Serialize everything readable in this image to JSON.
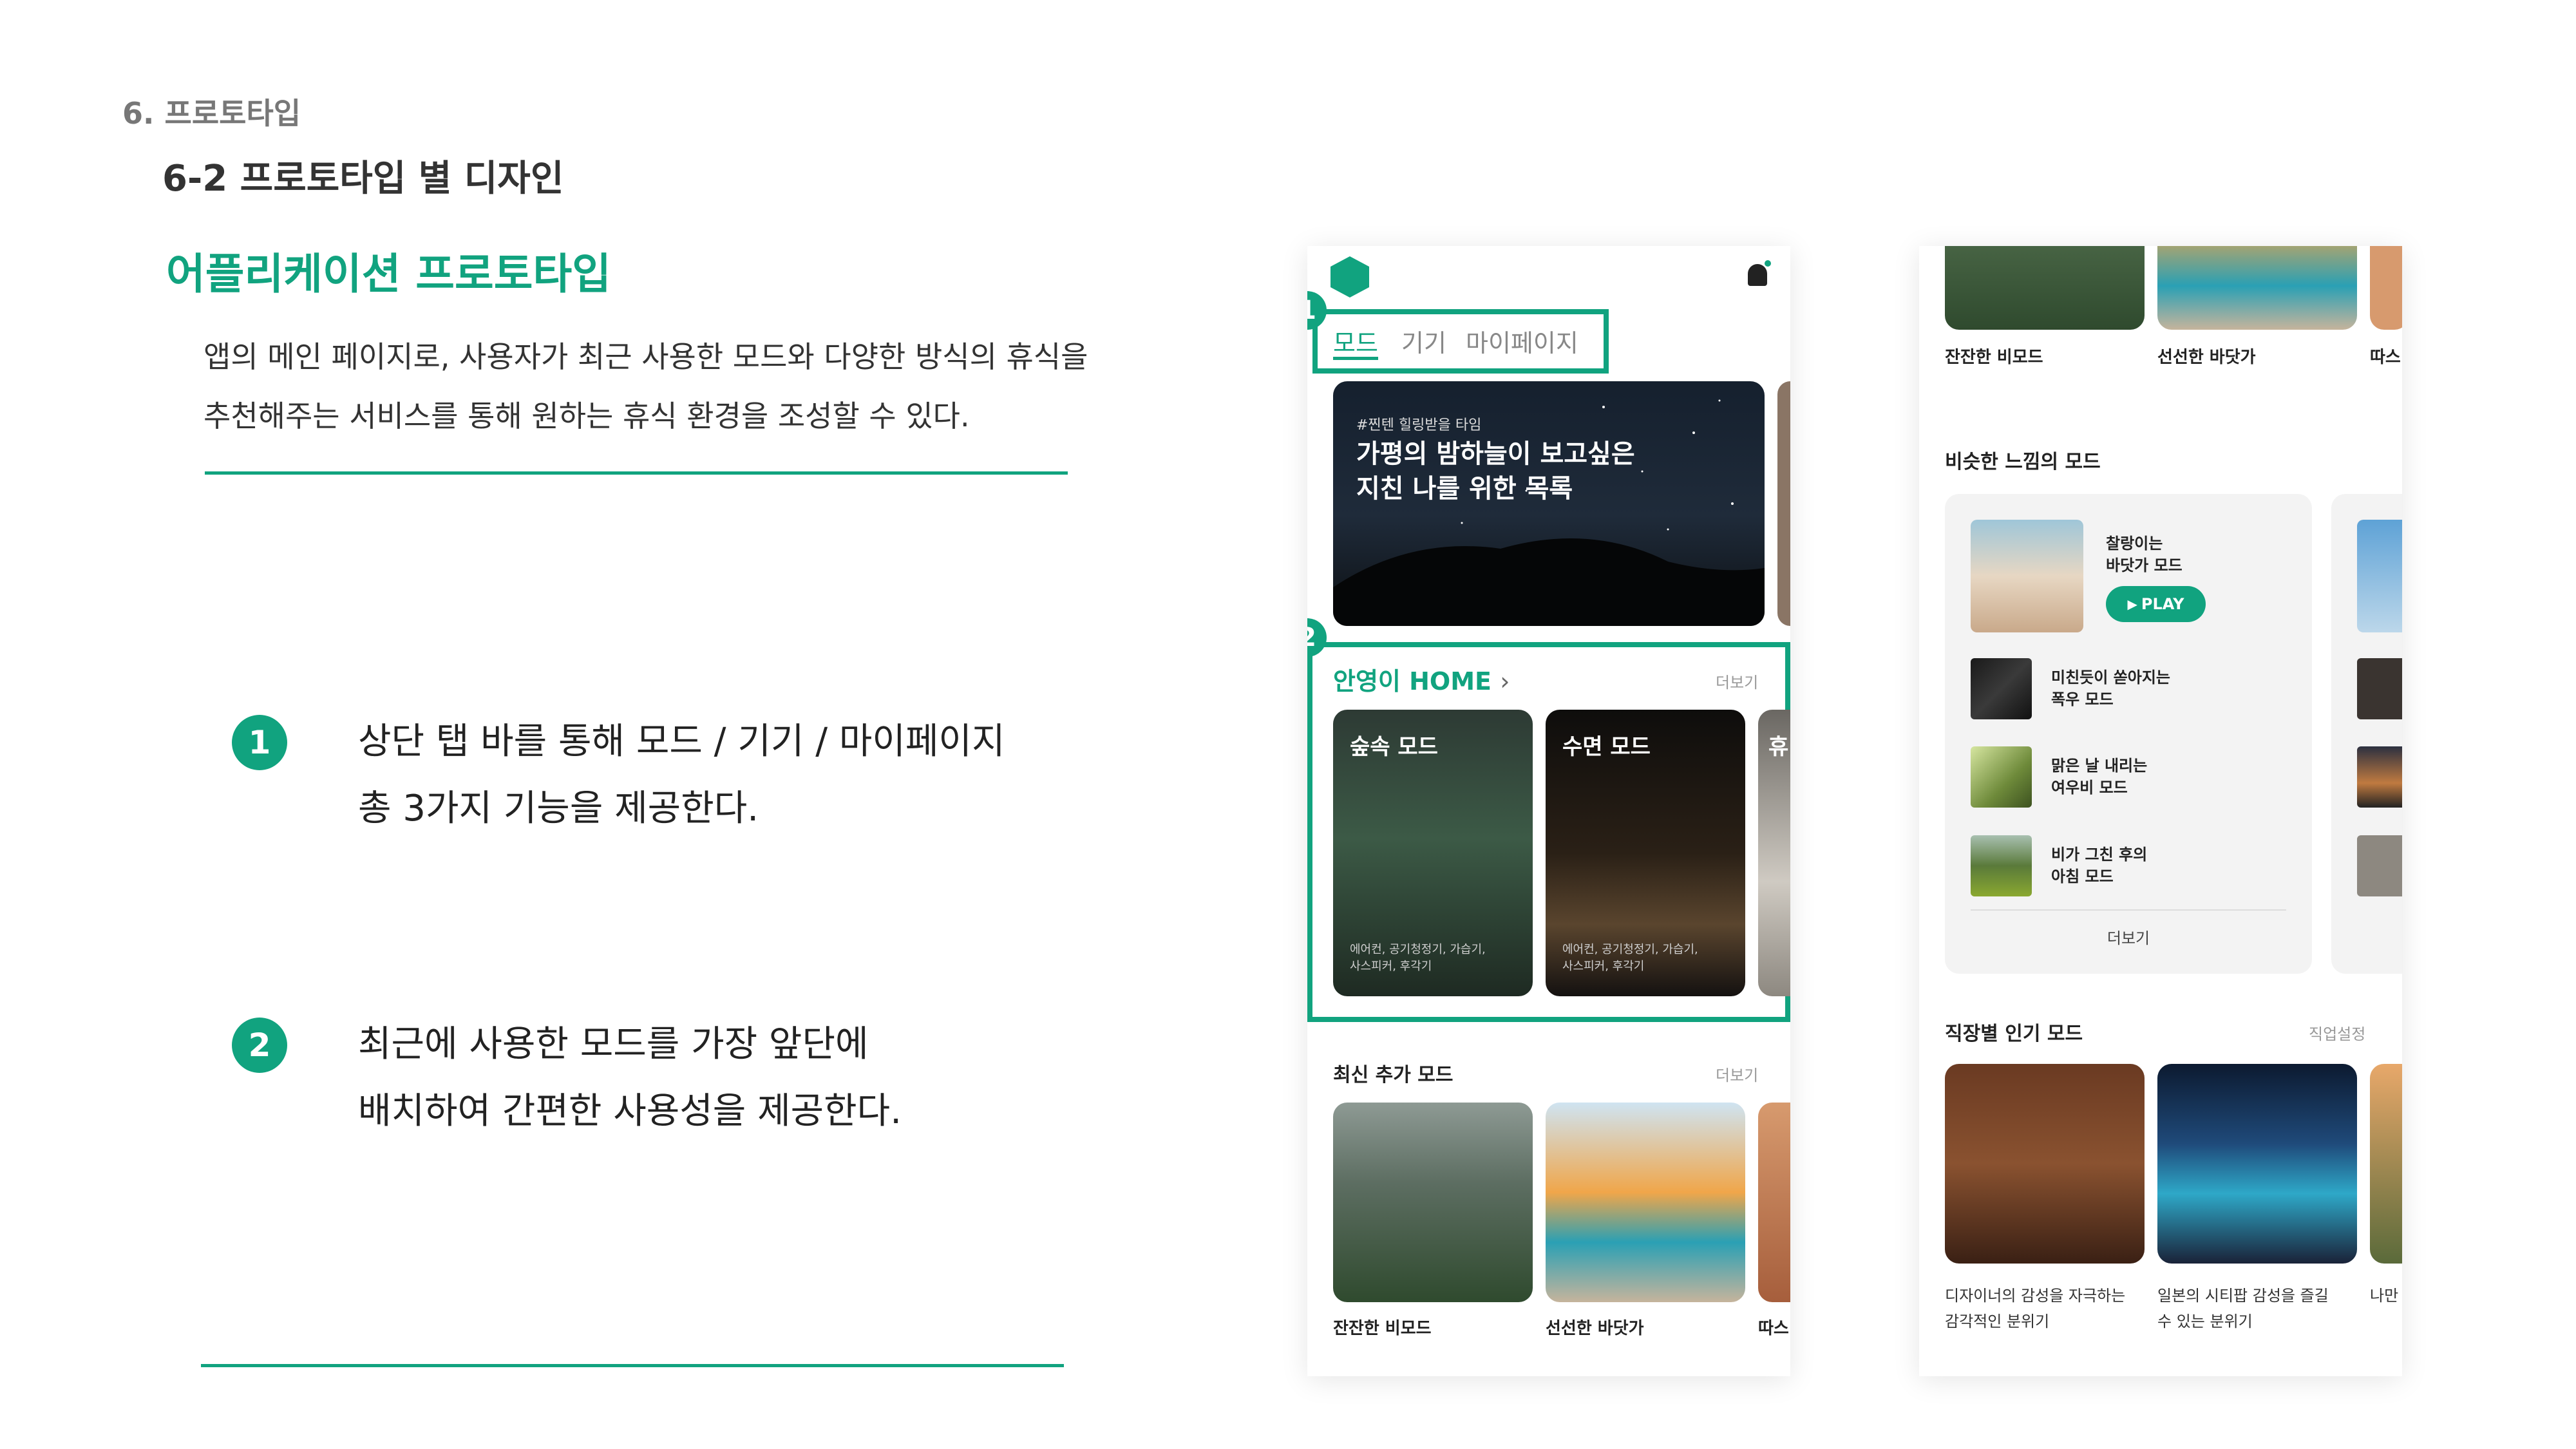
{
  "header": {
    "section": "6. 프로토타입",
    "sub_section": "6-2 프로토타입 별 디자인"
  },
  "intro": {
    "title": "어플리케이션 프로토타입",
    "description_line1": "앱의 메인 페이지로, 사용자가 최근 사용한 모드와 다양한 방식의 휴식을",
    "description_line2": "추천해주는 서비스를 통해 원하는 휴식 환경을 조성할 수 있다."
  },
  "points": [
    {
      "number": "1",
      "line1": "상단 탭 바를 통해 모드 / 기기 / 마이페이지",
      "line2": "총 3가지 기능을 제공한다."
    },
    {
      "number": "2",
      "line1": "최근에 사용한 모드를 가장 앞단에",
      "line2": "배치하여 간편한 사용성을 제공한다."
    }
  ],
  "phone_a": {
    "tabs": [
      "모드",
      "기기",
      "마이페이지"
    ],
    "badges": [
      "1",
      "2"
    ],
    "banner": {
      "tag": "#찐텐 힐링받을 타임",
      "title_line1": "가평의 밤하늘이 보고싶은",
      "title_line2": "지친 나를 위한 목록"
    },
    "home": {
      "title": "안영이 HOME",
      "more": "더보기"
    },
    "mode_cards": [
      {
        "title": "숲속 모드",
        "sub_line1": "에어컨, 공기청정기, 가습기,",
        "sub_line2": "사스피커, 후각기"
      },
      {
        "title": "수면 모드",
        "sub_line1": "에어컨, 공기청정기, 가습기,",
        "sub_line2": "사스피커, 후각기"
      },
      {
        "title": "휴"
      }
    ],
    "latest": {
      "title": "최신 추가 모드",
      "more": "더보기",
      "items": [
        "잔잔한 비모드",
        "선선한 바닷가",
        "따스"
      ]
    }
  },
  "phone_b": {
    "top_items": [
      "잔잔한 비모드",
      "선선한 바닷가",
      "따스"
    ],
    "similar": {
      "title": "비슷한 느낌의 모드",
      "featured_line1": "찰랑이는",
      "featured_line2": "바닷가 모드",
      "play_label": "PLAY",
      "items": [
        {
          "line1": "미친듯이 쏟아지는",
          "line2": "폭우 모드"
        },
        {
          "line1": "맑은 날 내리는",
          "line2": "여우비 모드"
        },
        {
          "line1": "비가 그친 후의",
          "line2": "아침 모드"
        }
      ],
      "more": "더보기"
    },
    "jobs": {
      "title": "직장별 인기 모드",
      "setting": "직업설정",
      "items": [
        {
          "line1": "디자이너의 감성을 자극하는",
          "line2": "감각적인 분위기"
        },
        {
          "line1": "일본의 시티팝 감성을 즐길",
          "line2": "수 있는 분위기"
        },
        {
          "line1": "나만",
          "line2": ""
        }
      ]
    }
  },
  "colors": {
    "accent": "#11a37f",
    "text": "#222222",
    "muted": "#999999"
  }
}
